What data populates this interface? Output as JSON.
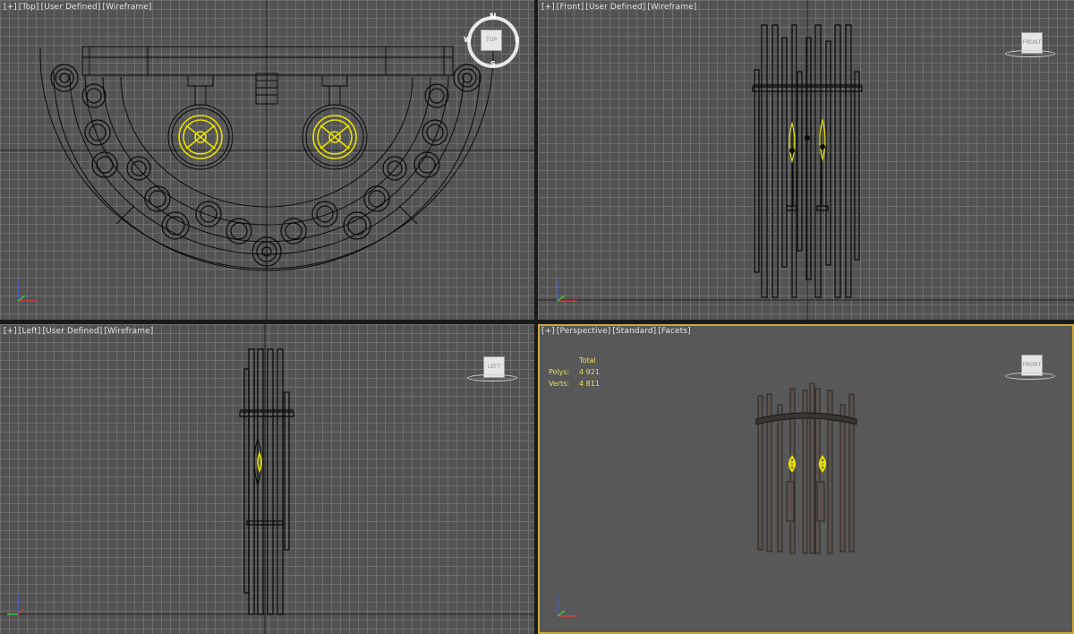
{
  "viewports": {
    "top": {
      "label": [
        "[+]",
        "[Top]",
        "[User Defined]",
        "[Wireframe]"
      ],
      "cube": "TOP",
      "compass": {
        "n": "N",
        "s": "S",
        "e": "E",
        "w": "W"
      }
    },
    "front": {
      "label": [
        "[+]",
        "[Front]",
        "[User Defined]",
        "[Wireframe]"
      ],
      "cube": "FRONT"
    },
    "left": {
      "label": [
        "[+]",
        "[Left]",
        "[User Defined]",
        "[Wireframe]"
      ],
      "cube": "LEFT"
    },
    "persp": {
      "label": [
        "[+]",
        "[Perspective]",
        "[Standard]",
        "[Facets]"
      ],
      "cube": "FRONT"
    }
  },
  "stats": {
    "header": "Total",
    "polys_label": "Polys:",
    "polys": "4 921",
    "verts_label": "Verts:",
    "verts": "4 811"
  },
  "colors": {
    "viewport_bg": "#535353",
    "grid": "#6e6e6e",
    "wire": "#0a0a0a",
    "selected": "#e8e000",
    "active_border": "#c8a93a"
  }
}
